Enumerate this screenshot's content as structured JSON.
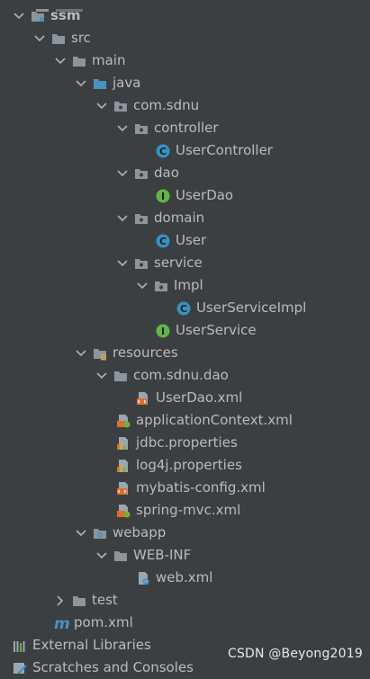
{
  "tree": {
    "root": "ssm",
    "src": "src",
    "main": "main",
    "java": "java",
    "pkg": "com.sdnu",
    "controller": "controller",
    "user_controller": "UserController",
    "dao": "dao",
    "user_dao": "UserDao",
    "domain": "domain",
    "user": "User",
    "service": "service",
    "impl": "Impl",
    "user_service_impl": "UserServiceImpl",
    "user_service": "UserService",
    "resources": "resources",
    "res_pkg": "com.sdnu.dao",
    "user_dao_xml": "UserDao.xml",
    "app_ctx": "applicationContext.xml",
    "jdbc_props": "jdbc.properties",
    "log4j_props": "log4j.properties",
    "mybatis_cfg": "mybatis-config.xml",
    "spring_mvc": "spring-mvc.xml",
    "webapp": "webapp",
    "web_inf": "WEB-INF",
    "web_xml": "web.xml",
    "test": "test",
    "pom": "pom.xml",
    "ext_libs": "External Libraries",
    "scratches": "Scratches and Consoles"
  },
  "watermark": "CSDN @Beyong2019",
  "colors": {
    "background": "#3c3f41",
    "text": "#bbbbbb",
    "folder": "#8c959c",
    "source_folder": "#4a90c2",
    "class_icon": "#3592c4",
    "interface_icon": "#62b543"
  }
}
